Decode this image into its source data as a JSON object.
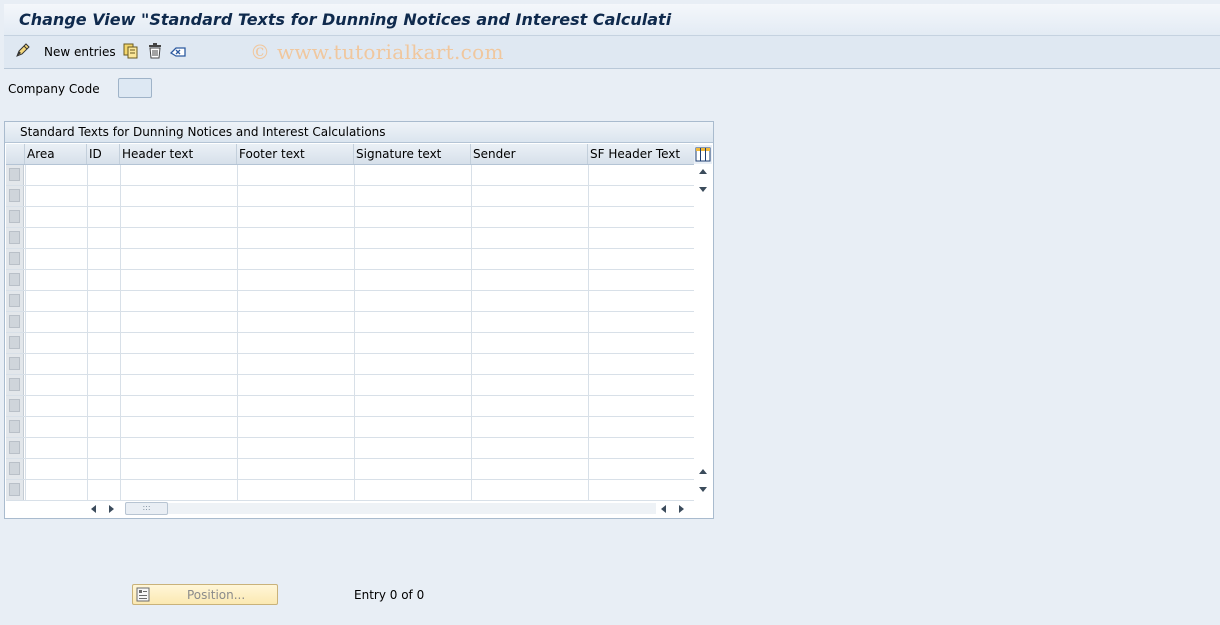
{
  "window": {
    "title": "Change View \"Standard Texts for Dunning Notices and Interest Calculati"
  },
  "toolbar": {
    "new_entries_label": "New entries",
    "icons": [
      "display-change-icon",
      "copy-icon",
      "delete-icon",
      "undo-icon"
    ]
  },
  "watermark": "© www.tutorialkart.com",
  "filter": {
    "company_code_label": "Company Code",
    "company_code_value": ""
  },
  "table": {
    "title": "Standard Texts for Dunning Notices and Interest Calculations",
    "columns": [
      "Area",
      "ID",
      "Header text",
      "Footer text",
      "Signature text",
      "Sender",
      "SF Header Text"
    ],
    "row_count_visible": 16,
    "rows": []
  },
  "footer": {
    "position_button_label": "Position...",
    "entry_text": "Entry 0 of 0"
  },
  "colors": {
    "background": "#e8eef5",
    "title_text": "#0f2a4d",
    "position_button": "#fbe9b2"
  }
}
